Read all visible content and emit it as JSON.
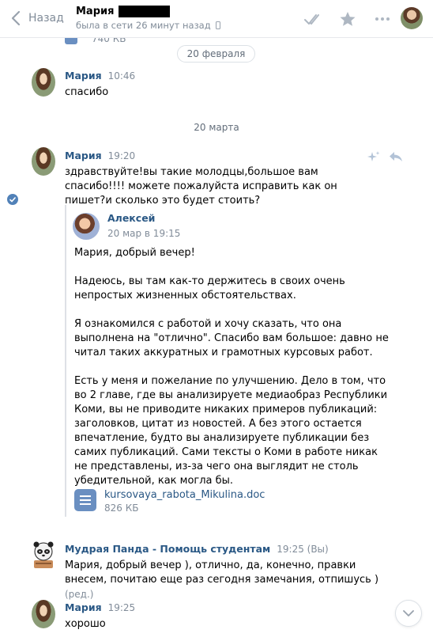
{
  "header": {
    "back_label": "Назад",
    "peer_name": "Мария",
    "peer_status": "была в сети 26 минут назад"
  },
  "feed": {
    "partial_file_size": "740 КБ",
    "date_pill": "20 февраля",
    "date_separator": "20 марта"
  },
  "messages": [
    {
      "author": "Мария",
      "time": "10:46",
      "text": "спасибо"
    },
    {
      "author": "Мария",
      "time": "19:20",
      "text": "здравствуйте!вы такие молодцы,большое вам спасибо!!!! можете пожалуйста исправить как он пишет?и сколько это будет стоить?",
      "forwarded": {
        "author": "Алексей",
        "time": "20 мар в 19:15",
        "paragraphs": [
          "Мария, добрый вечер!",
          "Надеюсь, вы там как-то держитесь в своих очень непростых жизненных обстоятельствах.",
          "Я ознакомился с работой и хочу сказать, что она выполнена на \"отлично\". Спасибо вам большое: давно не читал таких аккуратных и грамотных курсовых работ.",
          "Есть у меня и пожелание по улучшению. Дело в том, что во 2 главе, где вы анализируете медиаобраз Республики Коми, вы не приводите никаких примеров публикаций: заголовков, цитат из новостей. А без этого остается впечатление, будто вы анализируете публикации без самих публикаций. Сами тексты о Коми в работе никак не представлены, из-за чего она выглядит не столь убедительной, как могла бы."
        ],
        "attachment": {
          "name": "kursovaya_rabota_Mikulina.doc",
          "size": "826 КБ"
        }
      }
    },
    {
      "author": "Мудрая Панда - Помощь студентам",
      "time": "19:25 (Вы)",
      "text": "Мария, добрый вечер ), отлично, да, конечно, правки внесем, почитаю еще раз сегодня замечания, отпишусь )",
      "edited": "(ред.)"
    },
    {
      "author": "Мария",
      "time": "19:25",
      "text": "хорошо"
    }
  ],
  "colors": {
    "link": "#2a5885",
    "muted": "#818c99",
    "accent": "#5181b8"
  },
  "icons": [
    "chevron-left-icon",
    "phone-icon",
    "double-check-icon",
    "star-icon",
    "more-icon",
    "sparkle-icon",
    "reply-icon",
    "document-icon",
    "chevron-down-icon"
  ]
}
